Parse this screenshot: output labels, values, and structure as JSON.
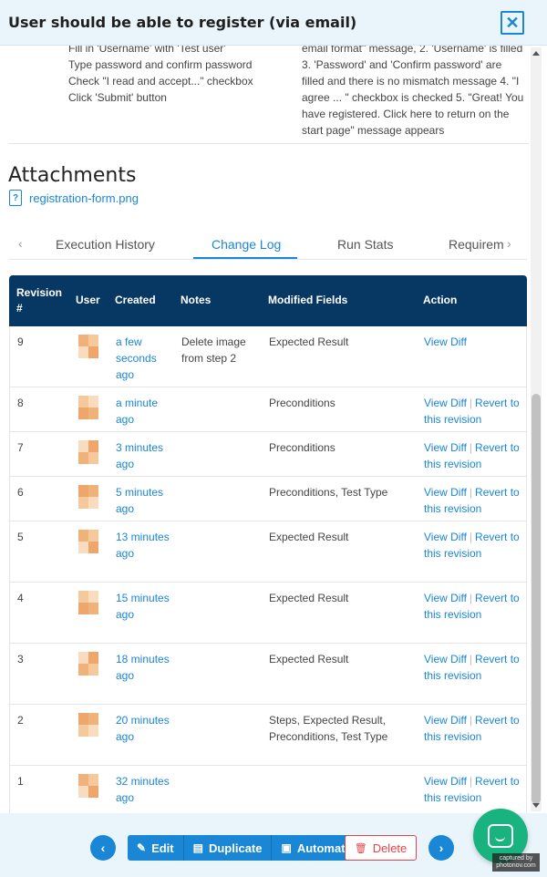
{
  "header": {
    "title": "User should be able to register (via email)",
    "close_label": "✕"
  },
  "steps": {
    "left_text": "Fill in 'Username' with 'Test user'\nType password and confirm password\nCheck \"I read and accept...\" checkbox\nClick 'Submit' button",
    "right_text": "email format\" message, 2. 'Username' is filled 3. 'Password' and 'Confirm password' are filled and there is no mismatch message 4. \"I agree ... \" checkbox is checked 5. \"Great! You have registered. Click here to return on the start page\" message appears"
  },
  "attachments": {
    "title": "Attachments",
    "file_name": "registration-form.png"
  },
  "tabs": [
    {
      "label": "Execution History"
    },
    {
      "label": "Change Log",
      "active": true
    },
    {
      "label": "Run Stats"
    },
    {
      "label": "Requirem"
    }
  ],
  "table": {
    "headers": {
      "revision": "Revision #",
      "user": "User",
      "created": "Created",
      "notes": "Notes",
      "modified": "Modified Fields",
      "action": "Action"
    },
    "rows": [
      {
        "rev": "9",
        "created": "a few seconds ago",
        "notes": "Delete image from step 2",
        "fields": "Expected Result",
        "view": "View Diff",
        "revert": ""
      },
      {
        "rev": "8",
        "created": "a minute ago",
        "notes": "",
        "fields": "Preconditions",
        "view": "View Diff",
        "revert": "Revert to this revision"
      },
      {
        "rev": "7",
        "created": "3 minutes ago",
        "notes": "",
        "fields": "Preconditions",
        "view": "View Diff",
        "revert": "Revert to this revision"
      },
      {
        "rev": "6",
        "created": "5 minutes ago",
        "notes": "",
        "fields": "Preconditions, Test Type",
        "view": "View Diff",
        "revert": "Revert to this revision"
      },
      {
        "rev": "5",
        "created": "13 minutes ago",
        "notes": "",
        "fields": "Expected Result",
        "view": "View Diff",
        "revert": "Revert to this revision"
      },
      {
        "rev": "4",
        "created": "15 minutes ago",
        "notes": "",
        "fields": "Expected Result",
        "view": "View Diff",
        "revert": "Revert to this revision"
      },
      {
        "rev": "3",
        "created": "18 minutes ago",
        "notes": "",
        "fields": "Expected Result",
        "view": "View Diff",
        "revert": "Revert to this revision"
      },
      {
        "rev": "2",
        "created": "20 minutes ago",
        "notes": "",
        "fields": "Steps, Expected Result, Preconditions, Test Type",
        "view": "View Diff",
        "revert": "Revert to this revision"
      },
      {
        "rev": "1",
        "created": "32 minutes ago",
        "notes": "",
        "fields": "",
        "view": "View Diff",
        "revert": "Revert to this revision"
      }
    ]
  },
  "footer": {
    "prev_icon": "chevron-left-icon",
    "next_icon": "chevron-right-icon",
    "edit_label": "Edit",
    "duplicate_label": "Duplicate",
    "automate_label": "Automate",
    "delete_label": "Delete"
  },
  "watermark": "captured by\nphotonov.com",
  "colors": {
    "accent": "#1a86d6",
    "table_header": "#073763",
    "danger": "#e0444a",
    "chat": "#19b380"
  }
}
